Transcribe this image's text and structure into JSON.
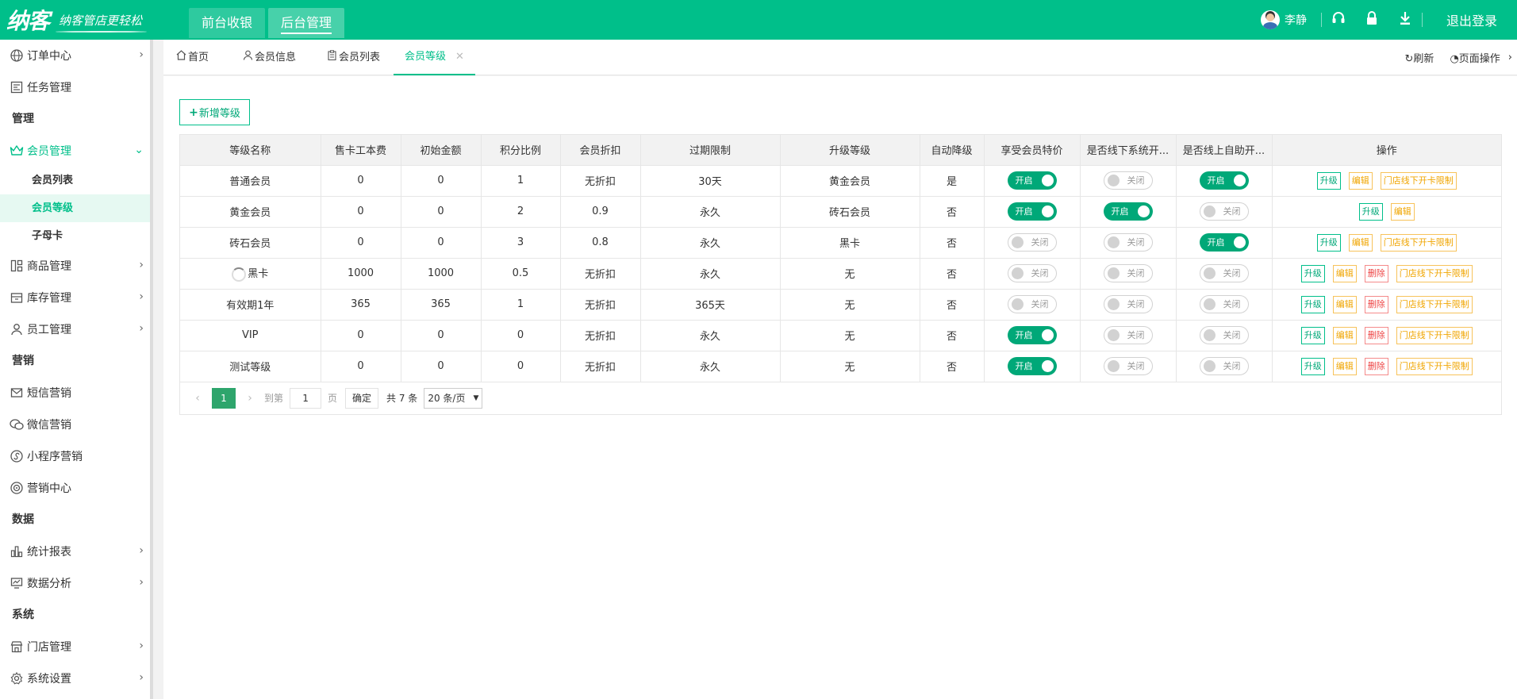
{
  "header": {
    "logo": "纳客",
    "slogan": "纳客管店更轻松",
    "nav_tabs": [
      "前台收银",
      "后台管理"
    ],
    "user_name": "李静",
    "logout_label": "退出登录",
    "accent_color": "#00bf8a"
  },
  "sidebar": {
    "items": [
      {
        "label": "订单中心",
        "icon": "globe-icon"
      },
      {
        "label": "任务管理",
        "icon": "task-icon"
      }
    ],
    "group_manage": "管理",
    "member_mgmt": {
      "label": "会员管理",
      "icon": "crown-icon"
    },
    "member_subs": [
      "会员列表",
      "会员等级",
      "子母卡"
    ],
    "items2": [
      {
        "label": "商品管理",
        "icon": "grid-icon"
      },
      {
        "label": "库存管理",
        "icon": "box-icon"
      },
      {
        "label": "员工管理",
        "icon": "user-icon"
      }
    ],
    "group_marketing": "营销",
    "items3": [
      {
        "label": "短信营销",
        "icon": "mail-icon"
      },
      {
        "label": "微信营销",
        "icon": "wechat-icon"
      },
      {
        "label": "小程序营销",
        "icon": "miniprogram-icon"
      },
      {
        "label": "营销中心",
        "icon": "target-icon"
      }
    ],
    "group_data": "数据",
    "items4": [
      {
        "label": "统计报表",
        "icon": "bar-chart-icon"
      },
      {
        "label": "数据分析",
        "icon": "analysis-icon"
      }
    ],
    "group_system": "系统",
    "items5": [
      {
        "label": "门店管理",
        "icon": "store-icon"
      },
      {
        "label": "系统设置",
        "icon": "gear-icon"
      }
    ]
  },
  "tabs": {
    "items": [
      "首页",
      "会员信息",
      "会员列表",
      "会员等级"
    ],
    "refresh": "刷新",
    "page_ops": "页面操作"
  },
  "toolbar": {
    "add_label": "新增等级"
  },
  "table": {
    "headers": [
      "等级名称",
      "售卡工本费",
      "初始金额",
      "积分比例",
      "会员折扣",
      "过期限制",
      "升级等级",
      "自动降级",
      "享受会员特价",
      "是否线下系统开...",
      "是否线上自助开...",
      "操作"
    ],
    "switch_on": "开启",
    "switch_off": "关闭",
    "op_upgrade": "升级",
    "op_edit": "编辑",
    "op_delete": "删除",
    "op_limit": "门店线下开卡限制",
    "rows": [
      {
        "name": "普通会员",
        "fee": "0",
        "init": "0",
        "points": "1",
        "discount": "无折扣",
        "expire": "30天",
        "upgrade": "黄金会员",
        "auto": "是",
        "special": true,
        "offline": false,
        "online": true
      },
      {
        "name": "黄金会员",
        "fee": "0",
        "init": "0",
        "points": "2",
        "discount": "0.9",
        "expire": "永久",
        "upgrade": "砖石会员",
        "auto": "否",
        "special": true,
        "offline": true,
        "online": false
      },
      {
        "name": "砖石会员",
        "fee": "0",
        "init": "0",
        "points": "3",
        "discount": "0.8",
        "expire": "永久",
        "upgrade": "黑卡",
        "auto": "否",
        "special": false,
        "offline": false,
        "online": true
      },
      {
        "name": "黑卡",
        "fee": "1000",
        "init": "1000",
        "points": "0.5",
        "discount": "无折扣",
        "expire": "永久",
        "upgrade": "无",
        "auto": "否",
        "special": false,
        "offline": false,
        "online": false
      },
      {
        "name": "有效期1年",
        "fee": "365",
        "init": "365",
        "points": "1",
        "discount": "无折扣",
        "expire": "365天",
        "upgrade": "无",
        "auto": "否",
        "special": false,
        "offline": false,
        "online": false
      },
      {
        "name": "VIP",
        "fee": "0",
        "init": "0",
        "points": "0",
        "discount": "无折扣",
        "expire": "永久",
        "upgrade": "无",
        "auto": "否",
        "special": true,
        "offline": false,
        "online": false
      },
      {
        "name": "测试等级",
        "fee": "0",
        "init": "0",
        "points": "0",
        "discount": "无折扣",
        "expire": "永久",
        "upgrade": "无",
        "auto": "否",
        "special": true,
        "offline": false,
        "online": false
      }
    ]
  },
  "pagination": {
    "current": "1",
    "goto_label": "到第",
    "page_input": "1",
    "page_label": "页",
    "confirm": "确定",
    "total": "共 7 条",
    "page_size": "20 条/页"
  }
}
